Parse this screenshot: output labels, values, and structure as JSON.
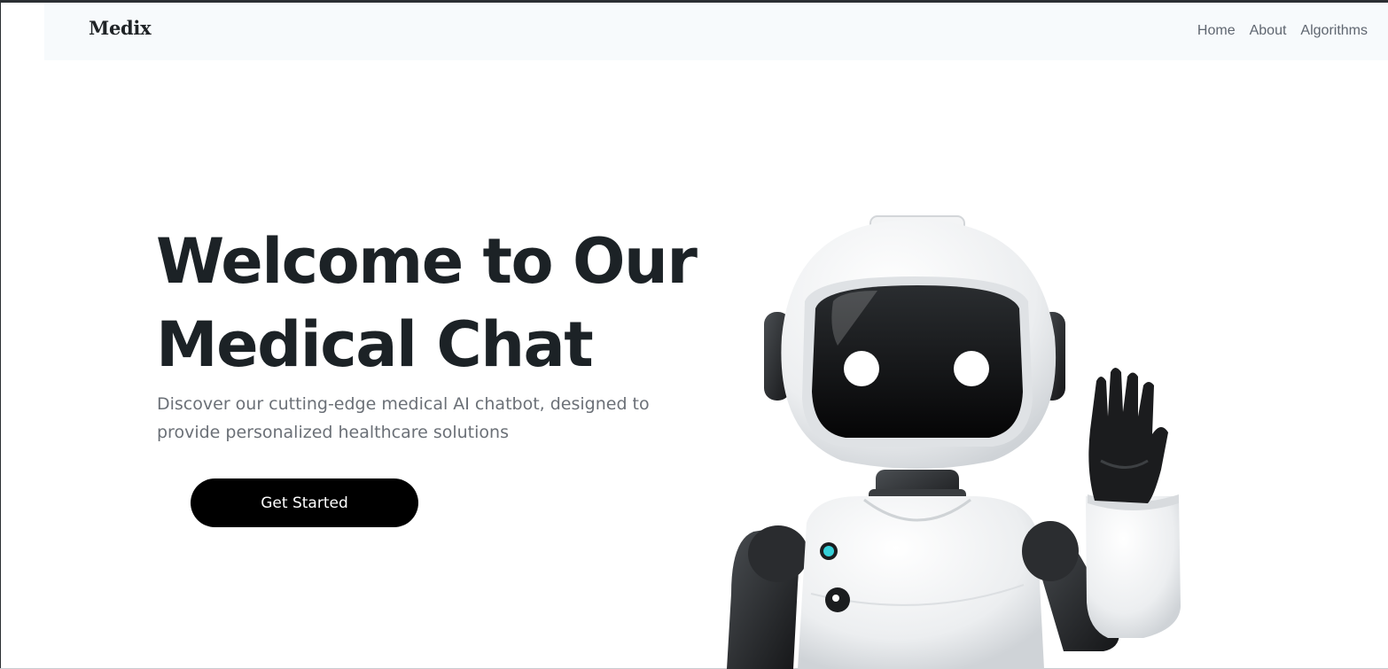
{
  "navbar": {
    "brand": "Medix",
    "links": [
      {
        "label": "Home"
      },
      {
        "label": "About"
      },
      {
        "label": "Algorithms"
      }
    ]
  },
  "hero": {
    "title_line1": "Welcome to Our",
    "title_line2": "Medical Chat",
    "subtitle_line1": "Discover our cutting-edge medical AI chatbot, designed to",
    "subtitle_line2": "provide personalized healthcare solutions",
    "cta_label": "Get Started"
  },
  "colors": {
    "navbar_bg": "#f7fafc",
    "title": "#1c2226",
    "subtitle": "#6b7077",
    "cta_bg": "#000000",
    "robot_led": "#35d0d8"
  },
  "illustration": {
    "icon": "waving-robot-illustration"
  }
}
